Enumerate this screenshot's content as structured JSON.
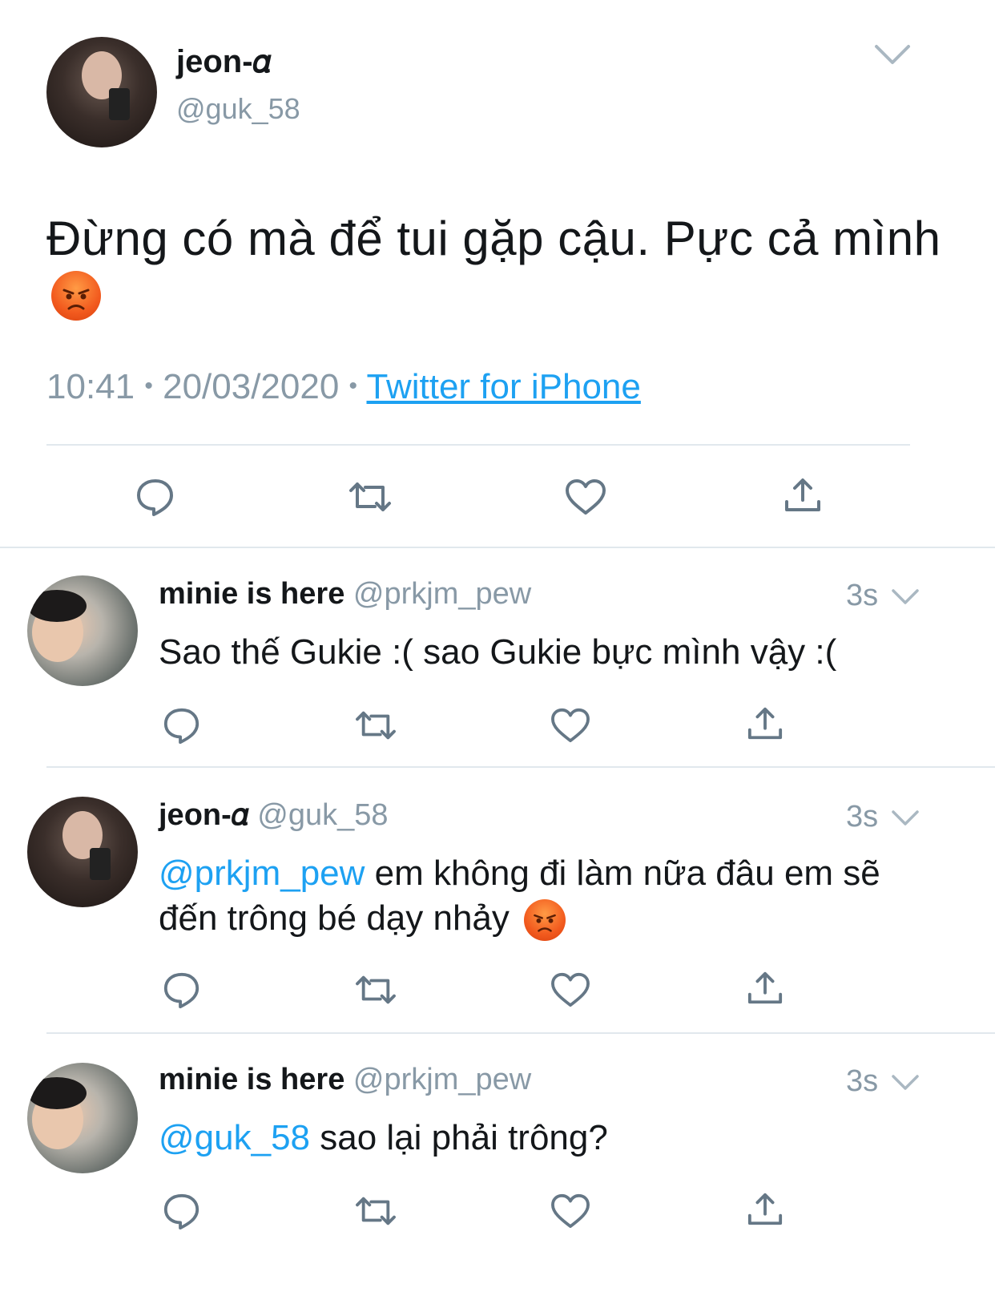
{
  "main_tweet": {
    "author_name": "jeon-𝛼",
    "author_handle": "@guk_58",
    "text": "Đừng có mà để tui gặp cậu. Pực cả mình",
    "emoji": "angry-face",
    "time": "10:41",
    "separator": "•",
    "date": "20/03/2020",
    "source": "Twitter for iPhone"
  },
  "action_icons": [
    "reply-icon",
    "retweet-icon",
    "like-icon",
    "share-icon"
  ],
  "replies": [
    {
      "author_name": "minie is here",
      "author_handle": "@prkjm_pew",
      "time": "3s",
      "mention": "",
      "text": "Sao thế Gukie :( sao Gukie bực mình vậy :("
    },
    {
      "author_name": "jeon-𝛼",
      "author_handle": "@guk_58",
      "time": "3s",
      "mention": "@prkjm_pew",
      "text": " em không đi làm nữa đâu em sẽ đến trông bé dạy nhảy"
    },
    {
      "author_name": "minie is here",
      "author_handle": "@prkjm_pew",
      "time": "3s",
      "mention": "@guk_58",
      "text": " sao lại phải trông?"
    }
  ],
  "colors": {
    "accent": "#1da1f2",
    "secondary_text": "#8899a6",
    "divider": "#e1e8ed",
    "icon": "#657786"
  }
}
